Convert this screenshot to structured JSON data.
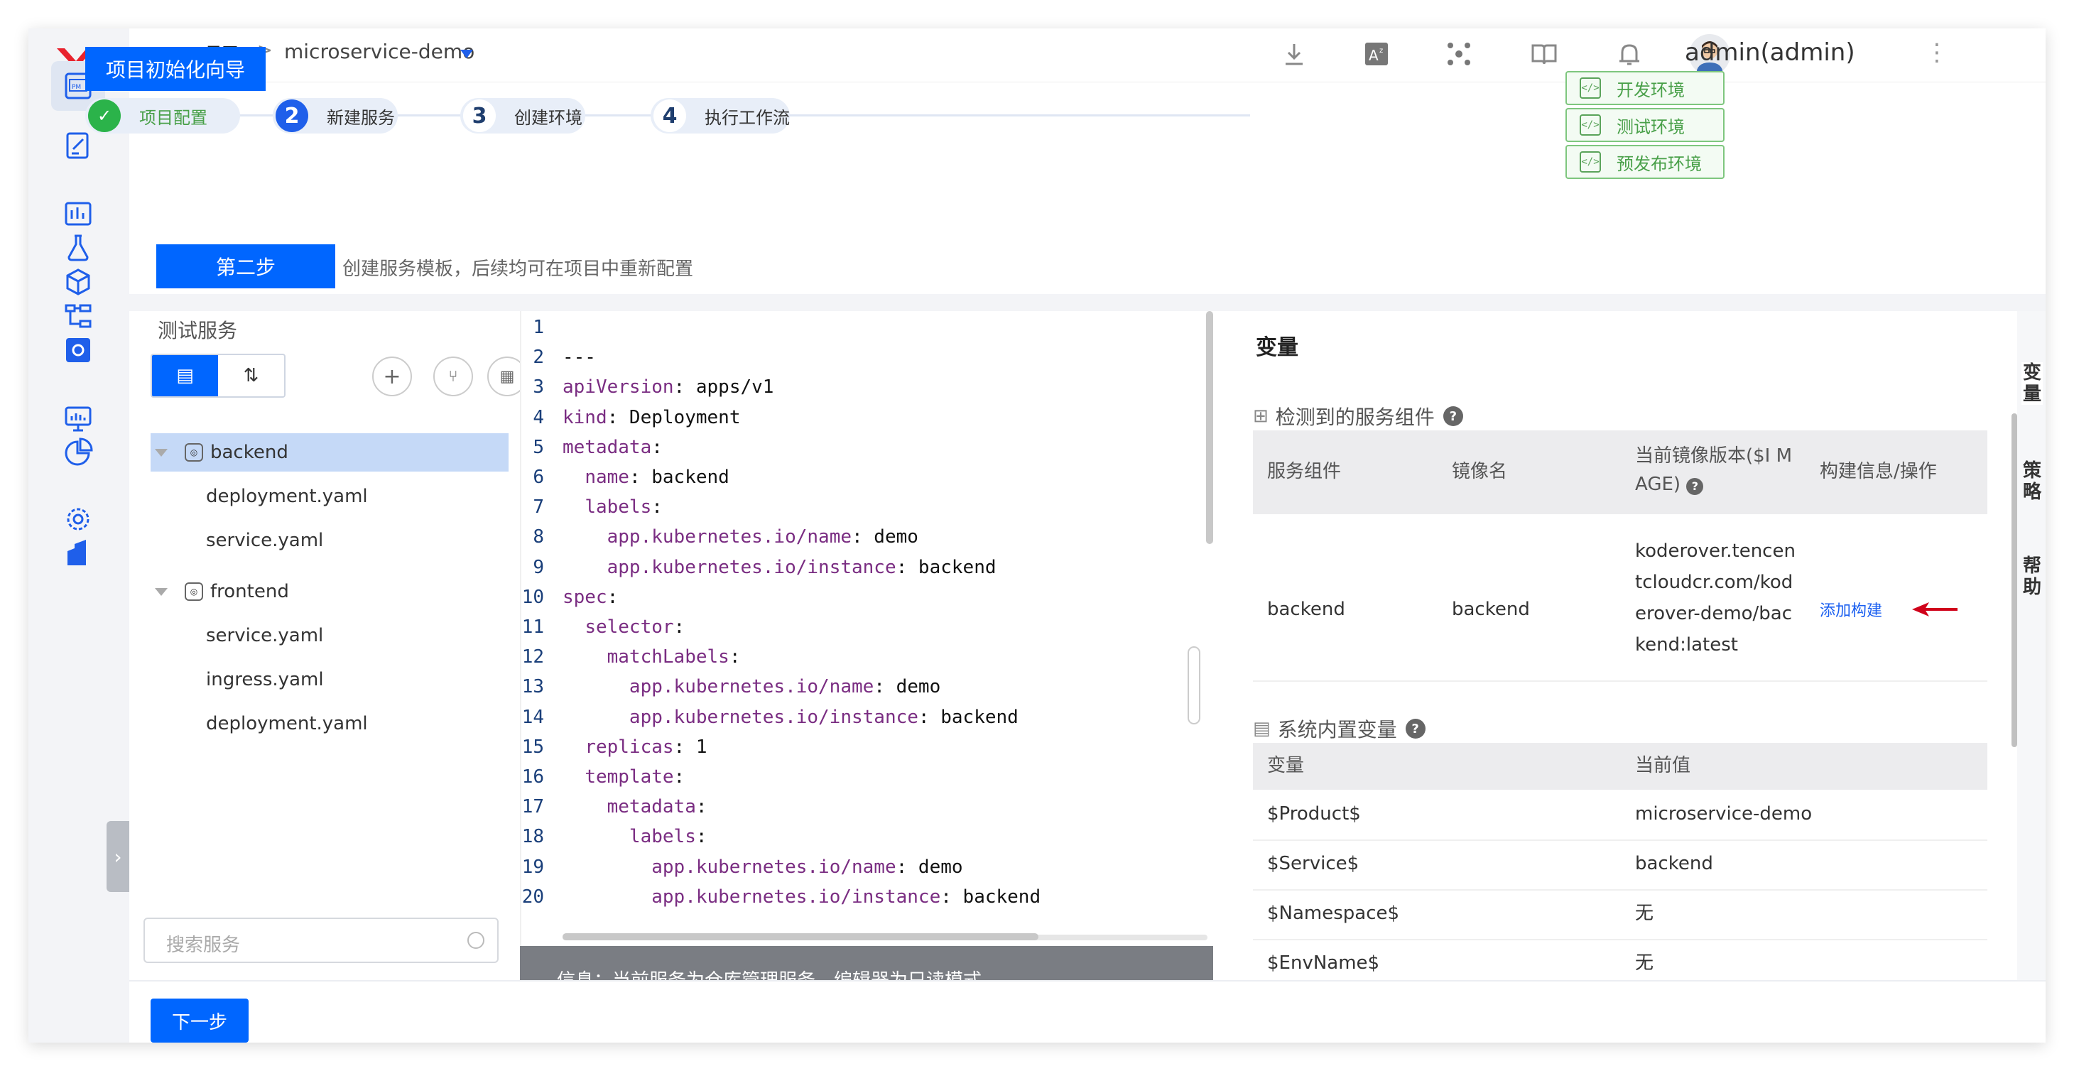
{
  "breadcrumb": {
    "project": "项目",
    "separator": ">",
    "name": "microservice-demo"
  },
  "topbar": {
    "icons": [
      "download-icon",
      "translate-icon",
      "network-icon",
      "book-icon",
      "bell-icon"
    ],
    "username": "admin(admin)",
    "more": "⋮"
  },
  "wizard": {
    "title": "项目初始化向导"
  },
  "steps": [
    {
      "num": "✓",
      "label": "项目配置",
      "state": "done"
    },
    {
      "num": "2",
      "label": "新建服务",
      "state": "active"
    },
    {
      "num": "3",
      "label": "创建环境",
      "state": "todo"
    },
    {
      "num": "4",
      "label": "执行工作流",
      "state": "todo"
    }
  ],
  "envs": [
    {
      "label": "开发环境",
      "icon": "</>"
    },
    {
      "label": "测试环境",
      "icon": "</>"
    },
    {
      "label": "预发布环境",
      "icon": "</>"
    }
  ],
  "step_label": "第二步",
  "step_desc": "创建服务模板，后续均可在项目中重新配置",
  "service_panel": {
    "title": "测试服务",
    "search_placeholder": "搜索服务",
    "services": [
      {
        "name": "backend",
        "files": [
          "deployment.yaml",
          "service.yaml"
        ]
      },
      {
        "name": "frontend",
        "files": [
          "service.yaml",
          "ingress.yaml",
          "deployment.yaml"
        ]
      }
    ]
  },
  "editor": {
    "lines": [
      {
        "n": "1",
        "indent": "",
        "k": "",
        "v": ""
      },
      {
        "n": "2",
        "indent": "",
        "k": "",
        "v": "---"
      },
      {
        "n": "3",
        "indent": "",
        "k": "apiVersion",
        "v": " apps/v1"
      },
      {
        "n": "4",
        "indent": "",
        "k": "kind",
        "v": " Deployment"
      },
      {
        "n": "5",
        "indent": "",
        "k": "metadata",
        "v": ""
      },
      {
        "n": "6",
        "indent": "  ",
        "k": "name",
        "v": " backend"
      },
      {
        "n": "7",
        "indent": "  ",
        "k": "labels",
        "v": ""
      },
      {
        "n": "8",
        "indent": "    ",
        "k": "app.kubernetes.io/name",
        "v": " demo"
      },
      {
        "n": "9",
        "indent": "    ",
        "k": "app.kubernetes.io/instance",
        "v": " backend"
      },
      {
        "n": "10",
        "indent": "",
        "k": "spec",
        "v": ""
      },
      {
        "n": "11",
        "indent": "  ",
        "k": "selector",
        "v": ""
      },
      {
        "n": "12",
        "indent": "    ",
        "k": "matchLabels",
        "v": ""
      },
      {
        "n": "13",
        "indent": "      ",
        "k": "app.kubernetes.io/name",
        "v": " demo"
      },
      {
        "n": "14",
        "indent": "      ",
        "k": "app.kubernetes.io/instance",
        "v": " backend"
      },
      {
        "n": "15",
        "indent": "  ",
        "k": "replicas",
        "v": " 1"
      },
      {
        "n": "16",
        "indent": "  ",
        "k": "template",
        "v": ""
      },
      {
        "n": "17",
        "indent": "    ",
        "k": "metadata",
        "v": ""
      },
      {
        "n": "18",
        "indent": "      ",
        "k": "labels",
        "v": ""
      },
      {
        "n": "19",
        "indent": "        ",
        "k": "app.kubernetes.io/name",
        "v": " demo"
      },
      {
        "n": "20",
        "indent": "        ",
        "k": "app.kubernetes.io/instance",
        "v": " backend"
      }
    ],
    "info": "信息：当前服务为仓库管理服务，编辑器为只读模式"
  },
  "variables": {
    "title": "变量",
    "detected_title": "检测到的服务组件",
    "detected_headers": [
      "服务组件",
      "镜像名",
      "当前镜像版本($I MAGE)",
      "构建信息/操作"
    ],
    "detected_rows": [
      {
        "component": "backend",
        "image": "backend",
        "version": "koderover.tencentcloudcr.com/koderover-demo/backend:latest",
        "action": "添加构建"
      }
    ],
    "system_title": "系统内置变量",
    "system_headers": [
      "变量",
      "当前值"
    ],
    "system_rows": [
      {
        "name": "$Product$",
        "value": "microservice-demo"
      },
      {
        "name": "$Service$",
        "value": "backend"
      },
      {
        "name": "$Namespace$",
        "value": "无"
      },
      {
        "name": "$EnvName$",
        "value": "无"
      }
    ]
  },
  "right_tabs": [
    "变量",
    "策略",
    "帮助"
  ],
  "footer": {
    "next": "下一步"
  },
  "colors": {
    "primary": "#0066ff",
    "success": "#49a049",
    "code_key": "#7a2d82",
    "link": "#1a5ff0",
    "arrow": "#d0021b"
  }
}
